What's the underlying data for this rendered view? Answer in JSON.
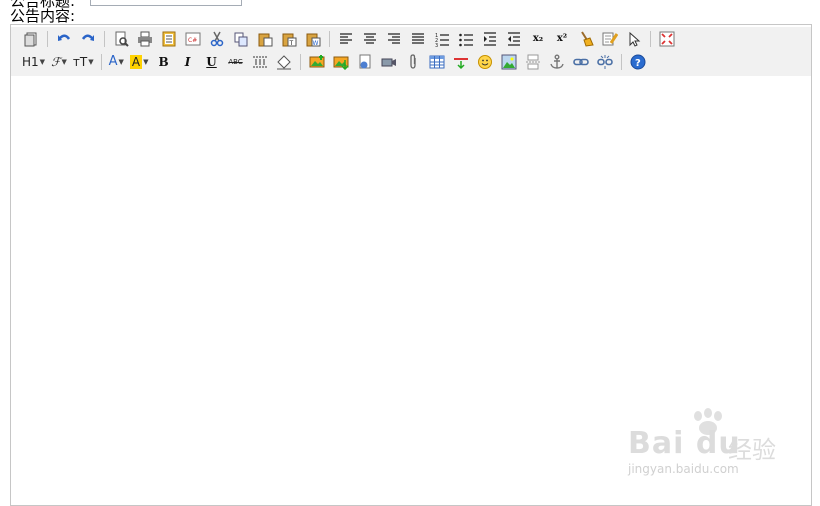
{
  "form": {
    "title_label": "公告标题:",
    "content_label": "公告内容:",
    "title_value": ""
  },
  "toolbar": {
    "heading_label": "H1",
    "font_family_label": "ℱ",
    "font_size_label": "тT",
    "font_color_label": "A",
    "bg_color_label": "A",
    "bold_label": "B",
    "italic_label": "I",
    "underline_label": "U",
    "strike_label": "ABC",
    "subscript_label": "x₂",
    "superscript_label": "x²",
    "source_label": "C#"
  },
  "watermark": {
    "brand": "Bai du",
    "brand_cn": "经验",
    "url": "jingyan.baidu.com"
  },
  "colors": {
    "toolbar_bg": "#f1f1f1",
    "border": "#c6c6c6",
    "icon_blue": "#2a64c8",
    "help_blue": "#2b6ccf"
  }
}
